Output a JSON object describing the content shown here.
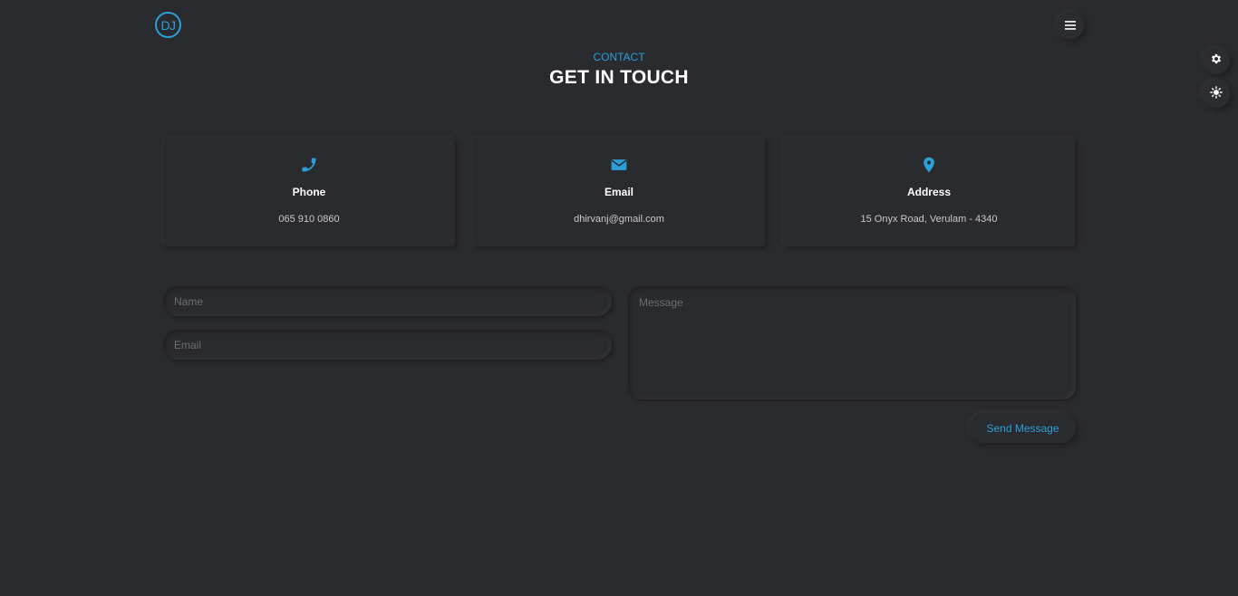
{
  "header": {
    "logo_text": "DJ",
    "menu_icon": "hamburger-icon"
  },
  "side_controls": {
    "settings_icon": "gear-icon",
    "theme_icon": "sun-icon"
  },
  "section": {
    "eyebrow": "CONTACT",
    "title": "GET IN TOUCH"
  },
  "cards": [
    {
      "icon": "phone-icon",
      "label": "Phone",
      "value": "065 910 0860"
    },
    {
      "icon": "envelope-icon",
      "label": "Email",
      "value": "dhirvanj@gmail.com"
    },
    {
      "icon": "map-pin-icon",
      "label": "Address",
      "value": "15 Onyx Road, Verulam - 4340"
    }
  ],
  "form": {
    "name_placeholder": "Name",
    "email_placeholder": "Email",
    "message_placeholder": "Message",
    "name_value": "",
    "email_value": "",
    "message_value": "",
    "submit_label": "Send Message"
  },
  "colors": {
    "background": "#2a2b2f",
    "accent": "#2a9fd8",
    "text": "#ffffff"
  }
}
